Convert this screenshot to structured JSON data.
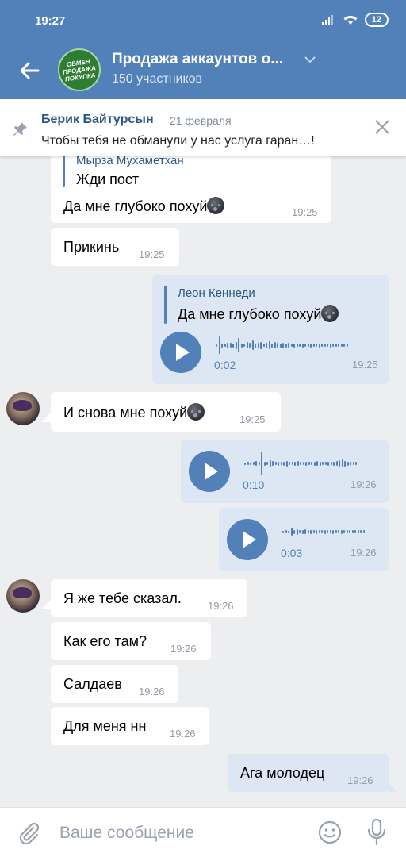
{
  "status_bar": {
    "time": "19:27",
    "battery": "12"
  },
  "header": {
    "title": "Продажа аккаунтов о...",
    "subtitle": "150 участников",
    "avatar_text": "ОБМЕН ПРОДАЖА ПОКУПКА",
    "accent": "#5181b8"
  },
  "pinned": {
    "author": "Берик Байтурсын",
    "date": "21 февраля",
    "text": "Чтобы тебя не обманули у нас услуга гаран…!"
  },
  "messages": [
    {
      "dir": "in",
      "reply_name": "Мырза Мухаметхан",
      "reply_text": "Жди пост",
      "text": "Да мне глубоко похуй",
      "emoji": "new-moon-face",
      "time": "19:25"
    },
    {
      "dir": "in",
      "text": "Прикинь",
      "time": "19:25"
    },
    {
      "dir": "out",
      "reply_name": "Леон Кеннеди",
      "reply_text": "Да мне глубоко похуй",
      "emoji": "new-moon-face",
      "voice_duration": "0:02",
      "time": "19:25"
    },
    {
      "dir": "in",
      "text": "И снова мне похуй",
      "emoji": "new-moon-face",
      "time": "19:25"
    },
    {
      "dir": "out",
      "voice_duration": "0:10",
      "time": "19:26"
    },
    {
      "dir": "out",
      "voice_duration": "0:03",
      "time": "19:26"
    },
    {
      "dir": "in",
      "text": "Я же тебе сказал.",
      "time": "19:26"
    },
    {
      "dir": "in",
      "text": "Как его там?",
      "time": "19:26"
    },
    {
      "dir": "in",
      "text": "Салдаев",
      "time": "19:26"
    },
    {
      "dir": "in",
      "text": "Для меня нн",
      "time": "19:26"
    },
    {
      "dir": "out",
      "text": "Ага молодец",
      "time": "19:26"
    }
  ],
  "composer": {
    "placeholder": "Ваше сообщение"
  }
}
